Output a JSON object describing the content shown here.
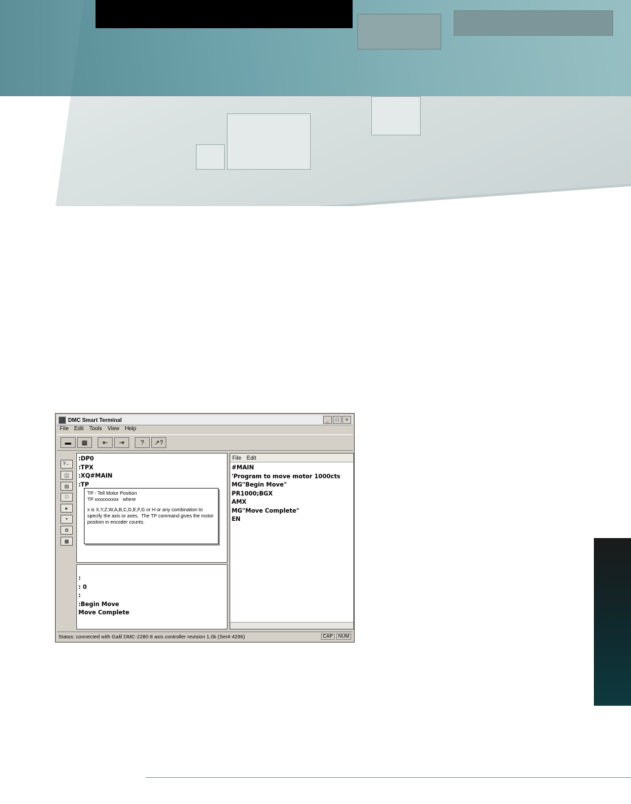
{
  "window": {
    "title": "DMC Smart Terminal",
    "controls": [
      "_",
      "□",
      "×"
    ]
  },
  "menubar": [
    "File",
    "Edit",
    "Tools",
    "View",
    "Help"
  ],
  "command_pane": {
    "lines": [
      ":DP0",
      ":TPX",
      ":XQ#MAIN",
      ":TP"
    ]
  },
  "tooltip": {
    "title": "TP - Tell Motor Position",
    "syntax": "TP xxxxxxxxxx   where",
    "body": "x is X,Y,Z,W,A,B,C,D,E,F,G or H or any combination to specify the axis or axes.  The TP command gives the motor position in encoder counts."
  },
  "response_pane": {
    "lines": [
      ":",
      ": 0",
      ":",
      ":Begin Move",
      "Move Complete"
    ]
  },
  "program_pane": {
    "menu": [
      "File",
      "Edit"
    ],
    "lines": [
      "#MAIN",
      "'Program to move motor 1000cts",
      "MG\"Begin Move\"",
      "PR1000;BGX",
      "AMX",
      "MG\"Move Complete\"",
      "EN"
    ]
  },
  "statusbar": {
    "text": "Status: connected with Galil DMC-2280 8 axis controller revision 1.0k (Ser# 4296)",
    "indicators": [
      "CAP",
      "NUM"
    ]
  },
  "colors": {
    "header_teal": "#4d8f99",
    "side_tab": "#0e3a40",
    "rule": "#8a94a8"
  }
}
